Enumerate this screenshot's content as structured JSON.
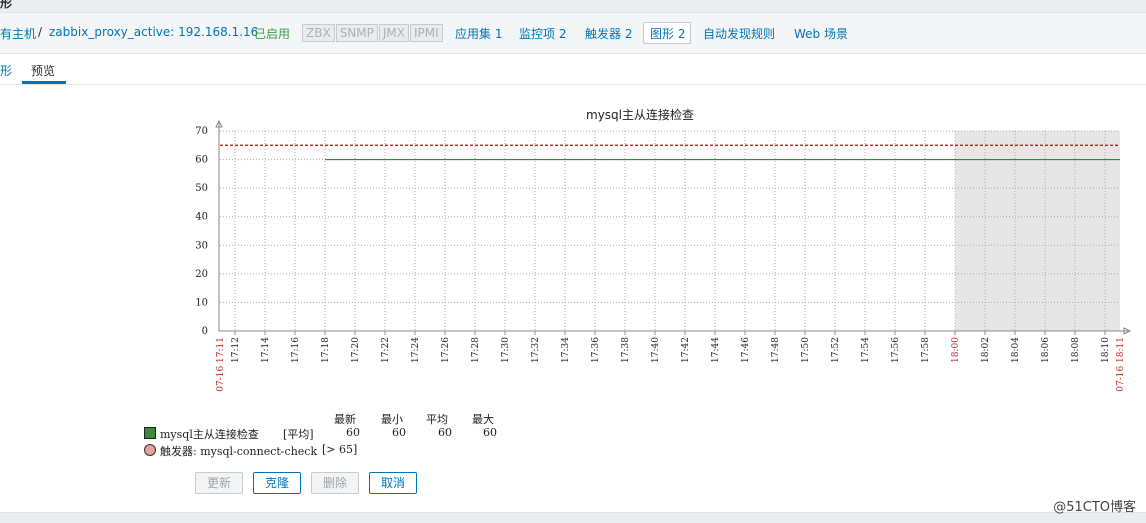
{
  "header": {
    "clipped_title": "形"
  },
  "breadcrumb": {
    "all_hosts": "有主机",
    "separator": "/",
    "host": "zabbix_proxy_active: 192.168.1.16",
    "status": "已启用",
    "tags": [
      "ZBX",
      "SNMP",
      "JMX",
      "IPMI"
    ],
    "nav": [
      "应用集 1",
      "监控项 2",
      "触发器 2",
      "图形 2",
      "自动发现规则",
      "Web 场景"
    ]
  },
  "tabs": {
    "graph": "形",
    "preview": "预览"
  },
  "chart_data": {
    "type": "line",
    "title": "mysql主从连接检查",
    "ylim": [
      0,
      70
    ],
    "yticks": [
      "0",
      "10",
      "20",
      "30",
      "40",
      "50",
      "60",
      "70"
    ],
    "xticks": [
      "17:12",
      "17:14",
      "17:16",
      "17:18",
      "17:20",
      "17:22",
      "17:24",
      "17:26",
      "17:28",
      "17:30",
      "17:32",
      "17:34",
      "17:36",
      "17:38",
      "17:40",
      "17:42",
      "17:44",
      "17:46",
      "17:48",
      "17:50",
      "17:52",
      "17:54",
      "17:56",
      "17:58",
      "18:00",
      "18:02",
      "18:04",
      "18:06",
      "18:08",
      "18:10"
    ],
    "x_range_labels": {
      "start": "07-16 17:11",
      "end": "07-16 18:11"
    },
    "series": [
      {
        "name": "mysql主从连接检查",
        "color": "#1a7a1a",
        "start": "17:18",
        "end": "18:11",
        "value": 60
      }
    ],
    "trigger": {
      "value": 65,
      "color": "#cc0000"
    },
    "grid": true,
    "shaded_from": "18:00"
  },
  "legend": {
    "headers": [
      "最新",
      "最小",
      "平均",
      "最大"
    ],
    "items": [
      {
        "name": "mysql主从连接检查",
        "func": "[平均]",
        "last": "60",
        "min": "60",
        "avg": "60",
        "max": "60",
        "color": "#3a8a3a"
      },
      {
        "name": "触发器: mysql-connect-check",
        "cond": "[> 65]",
        "color": "#e8a0a0"
      }
    ]
  },
  "buttons": {
    "update": "更新",
    "clone": "克隆",
    "delete": "删除",
    "cancel": "取消"
  },
  "watermark": "@51CTO博客"
}
